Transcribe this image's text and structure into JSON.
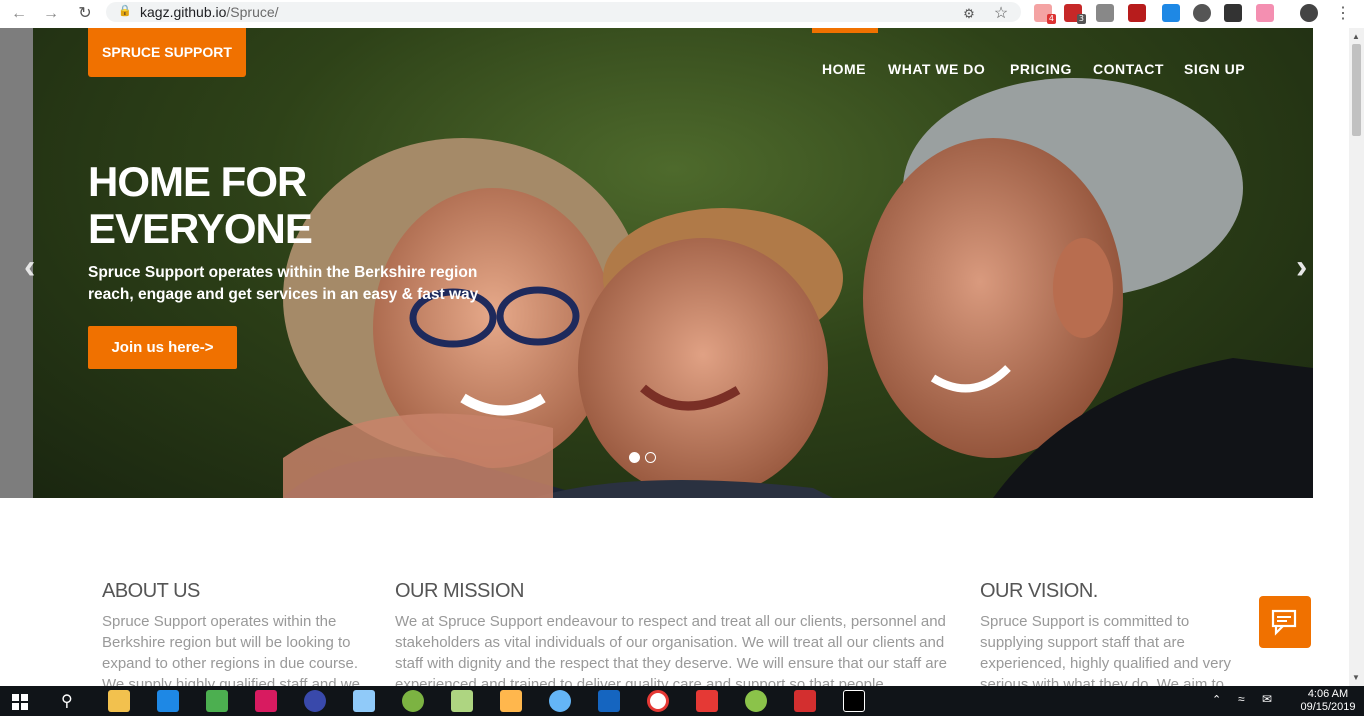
{
  "browser": {
    "url_host": "kagz.github.io",
    "url_path": "/Spruce/",
    "back_icon": "arrow-left-icon",
    "forward_icon": "arrow-right-icon",
    "reload_icon": "reload-icon",
    "ext_badges": [
      "4",
      "3"
    ]
  },
  "site": {
    "logo": "SPRUCE SUPPORT",
    "nav": [
      "HOME",
      "WHAT WE DO",
      "PRICING",
      "CONTACT",
      "SIGN UP"
    ],
    "active_nav": "HOME",
    "accent": "#f07100"
  },
  "hero": {
    "title": "HOME FOR EVERYONE",
    "subtitle_line1": "Spruce Support operates within the Berkshire region",
    "subtitle_line2": "reach, engage and get services in an easy & fast way",
    "cta": "Join us here->",
    "prev_icon": "chevron-left-icon",
    "next_icon": "chevron-right-icon",
    "slides": 2,
    "active_slide": 1
  },
  "sections": [
    {
      "title": "ABOUT US",
      "text": "Spruce Support operates within the Berkshire region but will be looking to expand to other regions in due course. We supply highly qualified staff and we"
    },
    {
      "title": "OUR MISSION",
      "text": "We at Spruce Support endeavour to respect and treat all our clients, personnel and stakeholders as vital individuals of our organisation. We will treat all our clients and staff with dignity and the respect that they deserve. We will ensure that our staff are experienced and trained to deliver quality care and support so that people"
    },
    {
      "title": "OUR VISION.",
      "text": "Spruce Support is committed to supplying support staff that are experienced, highly qualified and very serious with what they do. We aim to"
    }
  ],
  "taskbar": {
    "time": "4:06 AM",
    "date": "09/15/2019"
  }
}
